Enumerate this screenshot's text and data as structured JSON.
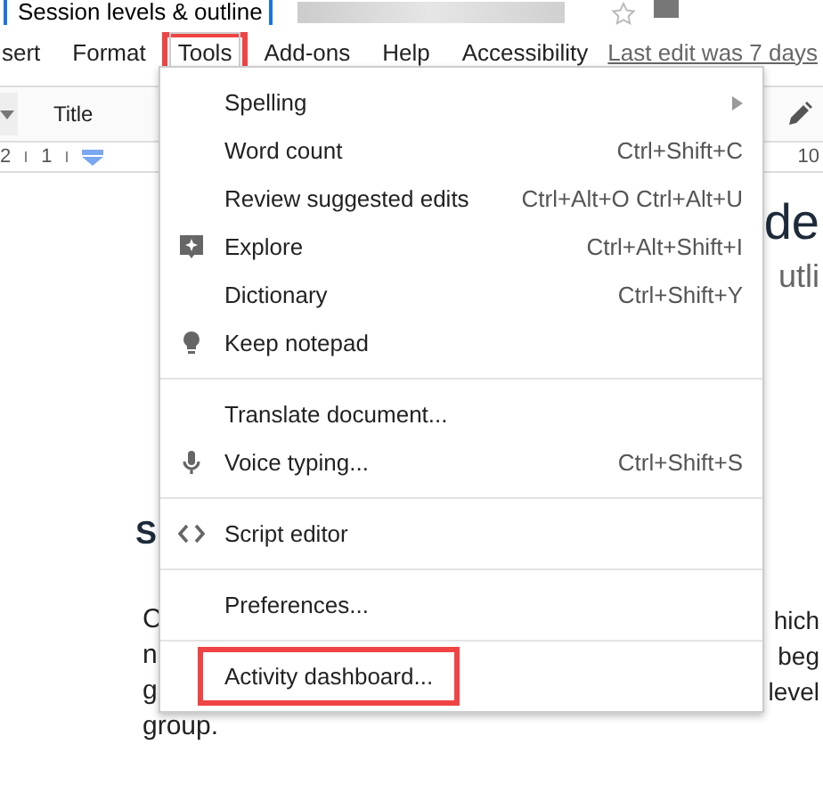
{
  "document_title": "Session levels & outline",
  "menubar": [
    {
      "label": "sert",
      "open": false,
      "highlighted": false
    },
    {
      "label": "Format",
      "open": false,
      "highlighted": false
    },
    {
      "label": "Tools",
      "open": true,
      "highlighted": true
    },
    {
      "label": "Add-ons",
      "open": false,
      "highlighted": false
    },
    {
      "label": "Help",
      "open": false,
      "highlighted": false
    },
    {
      "label": "Accessibility",
      "open": false,
      "highlighted": false
    }
  ],
  "last_edit": "Last edit was 7 days",
  "toolbar": {
    "style": "Title"
  },
  "ruler": {
    "left_numbers": [
      "2",
      "1"
    ],
    "right_number": "10"
  },
  "document": {
    "heading": "de",
    "subtitle": "utli",
    "section_heading": "S",
    "paragraph_lines": [
      {
        "left": "C",
        "right": "hich"
      },
      {
        "left": "n",
        "right": "beg"
      },
      {
        "left": "g",
        "right": "level"
      },
      {
        "left": "group."
      }
    ]
  },
  "tools_menu": [
    {
      "kind": "item",
      "label": "Spelling",
      "submenu": true,
      "highlighted": false
    },
    {
      "kind": "item",
      "label": "Word count",
      "shortcut": "Ctrl+Shift+C",
      "submenu": false,
      "highlighted": false
    },
    {
      "kind": "item",
      "label": "Review suggested edits",
      "shortcut": "Ctrl+Alt+O Ctrl+Alt+U",
      "submenu": false,
      "highlighted": false
    },
    {
      "kind": "item",
      "label": "Explore",
      "shortcut": "Ctrl+Alt+Shift+I",
      "submenu": false,
      "highlighted": false
    },
    {
      "kind": "item",
      "label": "Dictionary",
      "shortcut": "Ctrl+Shift+Y",
      "submenu": false,
      "highlighted": false
    },
    {
      "kind": "item",
      "label": "Keep notepad",
      "submenu": false,
      "highlighted": false
    },
    {
      "kind": "separator"
    },
    {
      "kind": "item",
      "label": "Translate document...",
      "submenu": false,
      "highlighted": false
    },
    {
      "kind": "item",
      "label": "Voice typing...",
      "shortcut": "Ctrl+Shift+S",
      "submenu": false,
      "highlighted": false
    },
    {
      "kind": "separator"
    },
    {
      "kind": "item",
      "label": "Script editor",
      "submenu": false,
      "highlighted": false
    },
    {
      "kind": "separator"
    },
    {
      "kind": "item",
      "label": "Preferences...",
      "submenu": false,
      "highlighted": false
    },
    {
      "kind": "separator"
    },
    {
      "kind": "item",
      "label": "Activity dashboard...",
      "submenu": false,
      "highlighted": true
    }
  ]
}
